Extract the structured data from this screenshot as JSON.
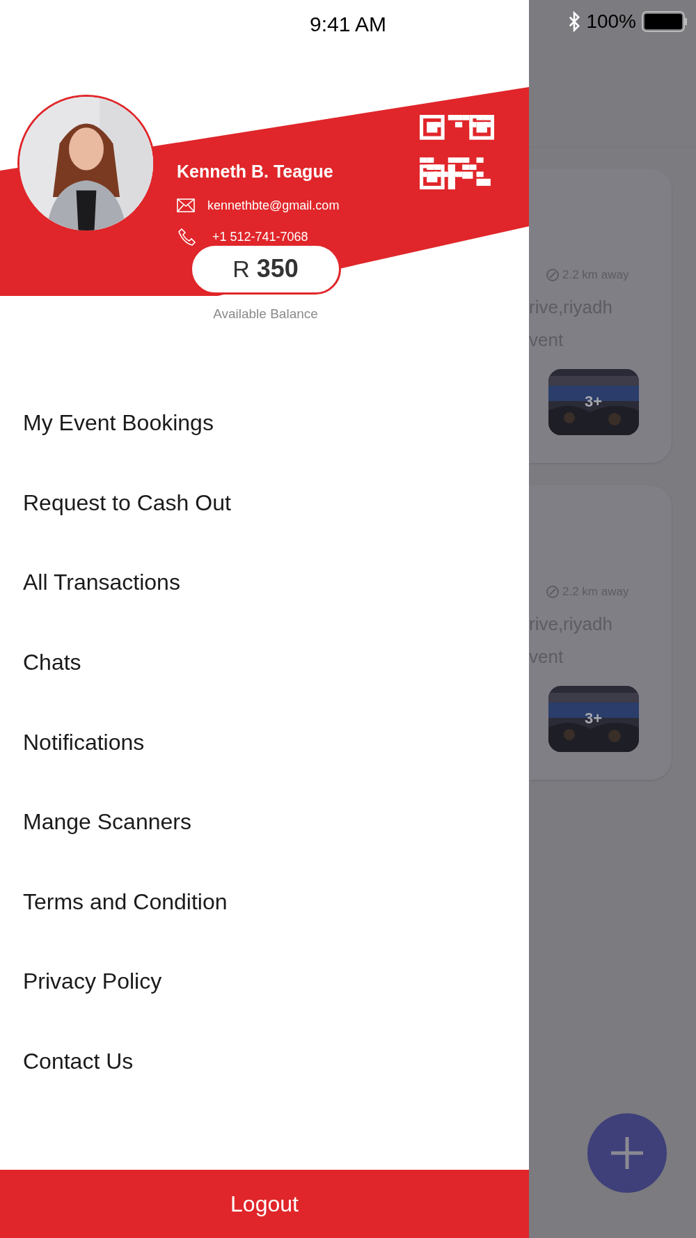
{
  "status_bar": {
    "time": "9:41 AM",
    "battery": "100%"
  },
  "profile": {
    "name": "Kenneth B. Teague",
    "email": "kennethbte@gmail.com",
    "phone": "+1 512-741-7068",
    "currency": "R",
    "amount": "350",
    "balance_label": "Available Balance"
  },
  "menu": [
    {
      "label": "My Event Bookings"
    },
    {
      "label": "Request to Cash Out"
    },
    {
      "label": "All Transactions"
    },
    {
      "label": "Chats"
    },
    {
      "label": "Notifications"
    },
    {
      "label": "Mange Scanners"
    },
    {
      "label": "Terms and Condition"
    },
    {
      "label": "Privacy Policy"
    },
    {
      "label": "Contact Us"
    }
  ],
  "logout": "Logout",
  "background_cards": [
    {
      "distance": "2.2 km away",
      "address": "rive,riyadh",
      "line": "vent",
      "more": "3+"
    },
    {
      "distance": "2.2 km away",
      "address": "rive,riyadh",
      "line": "vent",
      "more": "3+"
    }
  ]
}
